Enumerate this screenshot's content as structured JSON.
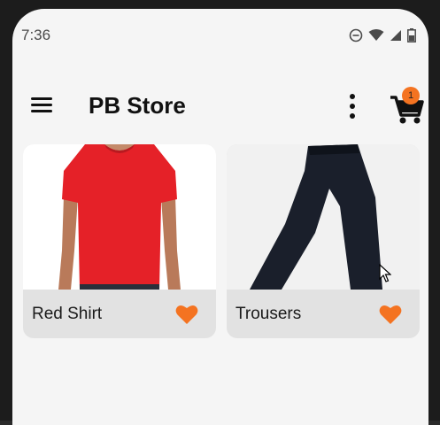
{
  "status_bar": {
    "time": "7:36"
  },
  "app_bar": {
    "title": "PB Store",
    "cart_badge": "1"
  },
  "products": [
    {
      "name": "Red Shirt",
      "favorited": true
    },
    {
      "name": "Trousers",
      "favorited": true
    }
  ],
  "colors": {
    "accent": "#f47321",
    "shirt": "#e52128",
    "trousers": "#1a1f2b"
  }
}
